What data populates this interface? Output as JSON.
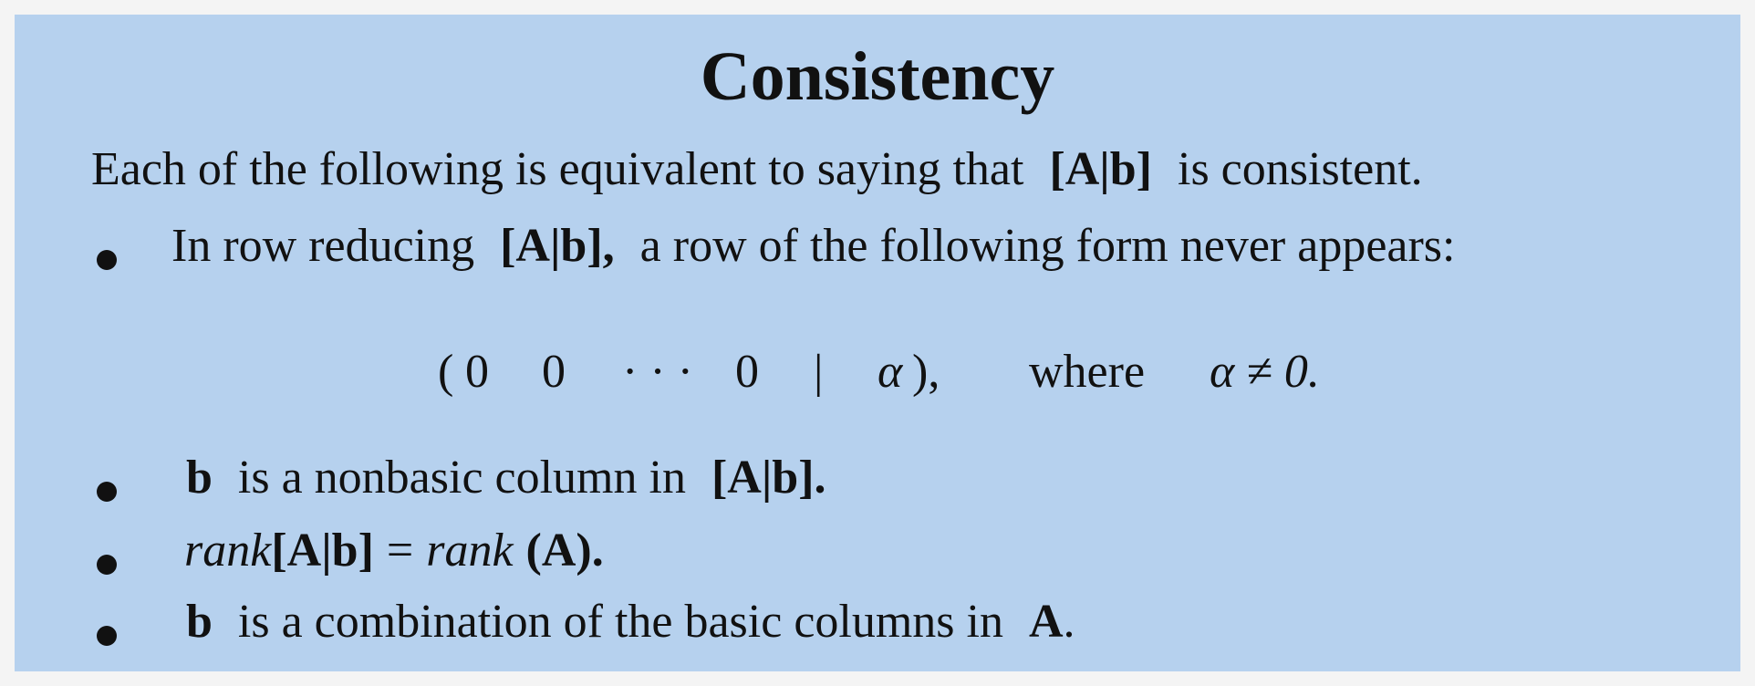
{
  "title": "Consistency",
  "intro": {
    "text_before": "Each of the following is equivalent to saying that",
    "matrix": "[A|b]",
    "text_after": "is consistent."
  },
  "bullet1": {
    "text_before": "In row reducing",
    "matrix": "[A|b],",
    "text_after": "a row of the following form never appears:"
  },
  "display_row": {
    "open": "(",
    "entry1": "0",
    "entry2": "0",
    "dots": "· · ·",
    "entry3": "0",
    "bar": "|",
    "alpha": "α",
    "close": "),",
    "where": "where",
    "condition": "α ≠ 0."
  },
  "bullet2": {
    "b": "b",
    "text": "is a nonbasic column in",
    "matrix": "[A|b]."
  },
  "bullet3": {
    "rank1": "rank",
    "matrix": "[A|b]",
    "equals": "=",
    "rank2": "rank",
    "arg": "(A)."
  },
  "bullet4": {
    "b": "b",
    "text": "is a combination of the basic columns in",
    "A": "A",
    "period": "."
  },
  "colors": {
    "panel_background": "#b6d1ee",
    "page_background": "#f4f4f4",
    "text": "#111111"
  }
}
